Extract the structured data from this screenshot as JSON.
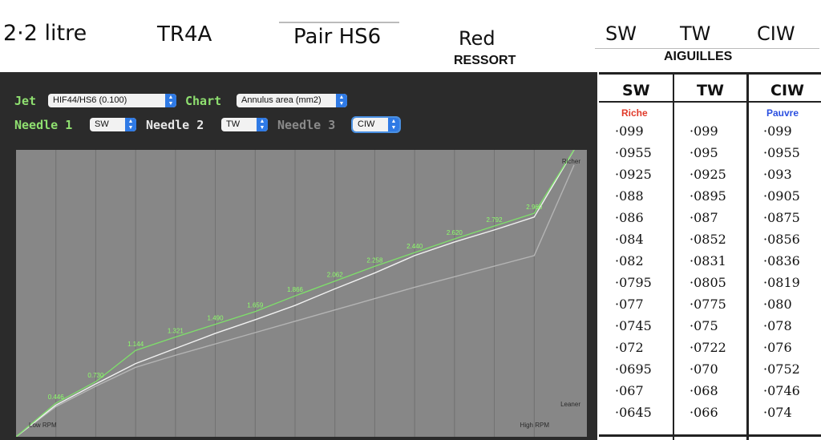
{
  "header": {
    "engine": "2·2 litre",
    "model": "TR4A",
    "carbs": "Pair HS6",
    "spring": "Red",
    "spring_label": "RESSORT",
    "needles": [
      "SW",
      "TW",
      "CIW"
    ],
    "needles_label": "AIGUILLES"
  },
  "controls": {
    "jet_label": "Jet",
    "jet_value": "HIF44/HS6 (0.100)",
    "chart_label": "Chart",
    "chart_value": "Annulus area (mm2)",
    "needle1_label": "Needle 1",
    "needle1_value": "SW",
    "needle2_label": "Needle 2",
    "needle2_value": "TW",
    "needle3_label": "Needle 3",
    "needle3_value": "CIW"
  },
  "chart_data": {
    "type": "line",
    "corner_labels": {
      "richer": "Richer",
      "leaner": "Leaner",
      "low": "Low RPM",
      "high": "High RPM"
    },
    "x": [
      0,
      1,
      2,
      3,
      4,
      5,
      6,
      7,
      8,
      9,
      10,
      11,
      12,
      13,
      14
    ],
    "ylim": [
      0,
      3.8
    ],
    "grid": true,
    "series": [
      {
        "color": "#7ee06a",
        "values": [
          0.0,
          0.446,
          0.73,
          1.144,
          1.321,
          1.49,
          1.659,
          1.866,
          2.062,
          2.258,
          2.44,
          2.62,
          2.792,
          2.96,
          3.8
        ],
        "labels": [
          "",
          "0.446",
          "0.730",
          "1.144",
          "1.321",
          "1.490",
          "1.659",
          "1.866",
          "2.062",
          "2.258",
          "2.440",
          "2.620",
          "2.792",
          "2.960",
          ""
        ]
      },
      {
        "color": "#f2f2f2",
        "values": [
          0.0,
          0.42,
          0.7,
          0.97,
          1.17,
          1.37,
          1.55,
          1.74,
          1.96,
          2.17,
          2.4,
          2.58,
          2.74,
          2.91,
          3.8
        ],
        "labels": []
      },
      {
        "color": "#b4b4b4",
        "values": [
          0.0,
          0.4,
          0.67,
          0.92,
          1.08,
          1.23,
          1.38,
          1.53,
          1.68,
          1.83,
          1.98,
          2.12,
          2.26,
          2.4,
          3.6
        ],
        "labels": []
      }
    ]
  },
  "table": {
    "columns": [
      {
        "name": "SW",
        "tag": "Riche",
        "values": [
          "·099",
          "·0955",
          "·0925",
          "·088",
          "·086",
          "·084",
          "·082",
          "·0795",
          "·077",
          "·0745",
          "·072",
          "·0695",
          "·067",
          "·0645"
        ]
      },
      {
        "name": "TW",
        "tag": "",
        "values": [
          "·099",
          "·095",
          "·0925",
          "·0895",
          "·087",
          "·0852",
          "·0831",
          "·0805",
          "·0775",
          "·075",
          "·0722",
          "·070",
          "·068",
          "·066"
        ]
      },
      {
        "name": "CIW",
        "tag": "Pauvre",
        "values": [
          "·099",
          "·0955",
          "·093",
          "·0905",
          "·0875",
          "·0856",
          "·0836",
          "·0819",
          "·080",
          "·078",
          "·076",
          "·0752",
          "·0746",
          "·074"
        ]
      }
    ],
    "tag_colors": {
      "rich": "#e03a2a",
      "poor": "#2a4fe0"
    }
  }
}
